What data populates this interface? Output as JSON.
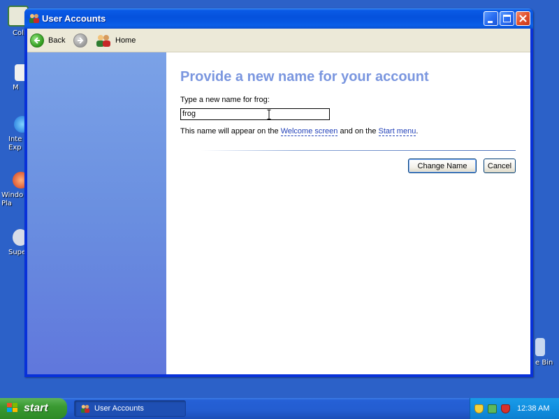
{
  "desktop": {
    "icons": [
      {
        "name": "collection-icon",
        "label": "Coll"
      },
      {
        "name": "my-icon",
        "label": "M"
      },
      {
        "name": "internet-explorer-icon",
        "label": "Inte\nExp"
      },
      {
        "name": "windows-media-player-icon",
        "label": "Windo\nPla"
      },
      {
        "name": "super-icon",
        "label": "Supe"
      },
      {
        "name": "recycle-bin-icon",
        "label": "e Bin"
      }
    ]
  },
  "window": {
    "title": "User Accounts",
    "toolbar": {
      "back_label": "Back",
      "home_label": "Home"
    },
    "main": {
      "heading": "Provide a new name for your account",
      "field_label": "Type a new name for frog:",
      "input_value": "frog",
      "note_prefix": "This name will appear on the ",
      "welcome_link": "Welcome screen",
      "note_middle": " and on the ",
      "start_link": "Start menu",
      "note_suffix": ".",
      "change_button": "Change Name",
      "cancel_button": "Cancel"
    }
  },
  "taskbar": {
    "start_label": "start",
    "task_item_label": "User Accounts",
    "clock": "12:38 AM"
  },
  "colors": {
    "heading": "#7a96df",
    "link": "#2140b8",
    "titlebar": "#0551dc",
    "task_pane": "#6a8fe0",
    "start_green": "#3a9a32"
  }
}
